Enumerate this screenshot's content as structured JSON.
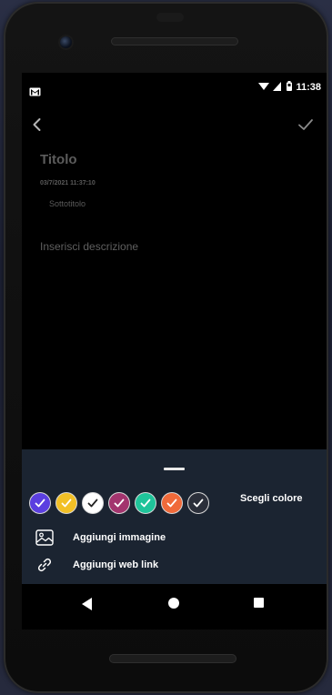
{
  "status_bar": {
    "time": "11:38",
    "notification_icon": "gmail-icon",
    "icons": [
      "wifi-icon",
      "signal-icon",
      "battery-icon"
    ]
  },
  "app_bar": {
    "back_icon": "chevron-left-icon",
    "confirm_icon": "check-icon"
  },
  "note": {
    "title_placeholder": "Titolo",
    "timestamp": "03/7/2021 11:37:10",
    "subtitle_placeholder": "Sottotitolo",
    "description_placeholder": "Inserisci descrizione"
  },
  "bottom_sheet": {
    "colors": [
      {
        "name": "purple",
        "hex": "#5b3fe0"
      },
      {
        "name": "yellow",
        "hex": "#f2c026"
      },
      {
        "name": "white",
        "hex": "#ffffff"
      },
      {
        "name": "magenta",
        "hex": "#a3346e"
      },
      {
        "name": "teal",
        "hex": "#1fc49a"
      },
      {
        "name": "orange",
        "hex": "#f06a3a"
      },
      {
        "name": "dark",
        "hex": "#2b2f3a"
      }
    ],
    "choose_color_label": "Scegli colore",
    "add_image_label": "Aggiungi immagine",
    "add_link_label": "Aggiungi web link"
  },
  "nav_bar": {
    "icons": [
      "nav-back-icon",
      "nav-home-icon",
      "nav-recents-icon"
    ]
  },
  "theme": {
    "screen_bg": "#000000",
    "sheet_bg": "#1b2431",
    "placeholder_text": "#5c5c5c"
  }
}
